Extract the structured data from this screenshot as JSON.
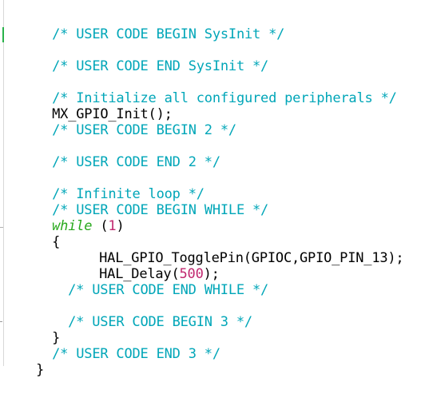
{
  "editor": {
    "colors": {
      "comment": "#00a6b8",
      "keyword": "#27a81c",
      "number": "#c0266e",
      "text": "#000000",
      "background": "#ffffff"
    },
    "lines": [
      {
        "comment": "/* USER CODE BEGIN SysInit */"
      },
      {
        "comment": "/* USER CODE END SysInit */"
      },
      {
        "comment": "/* Initialize all configured peripherals */"
      },
      {
        "text": "MX_GPIO_Init();"
      },
      {
        "comment": "/* USER CODE BEGIN 2 */"
      },
      {
        "comment": "/* USER CODE END 2 */"
      },
      {
        "comment": "/* Infinite loop */"
      },
      {
        "comment": "/* USER CODE BEGIN WHILE */"
      },
      {
        "keyword": "while",
        "open": " (",
        "number": "1",
        "close": ")"
      },
      {
        "text": "{"
      },
      {
        "text": "HAL_GPIO_TogglePin(GPIOC,GPIO_PIN_13);"
      },
      {
        "text": "HAL_Delay(",
        "number": "500",
        "close": ");"
      },
      {
        "comment": "/* USER CODE END WHILE */"
      },
      {
        "comment": "/* USER CODE BEGIN 3 */"
      },
      {
        "text": "}"
      },
      {
        "comment": "/* USER CODE END 3 */"
      },
      {
        "text": "}"
      }
    ]
  }
}
